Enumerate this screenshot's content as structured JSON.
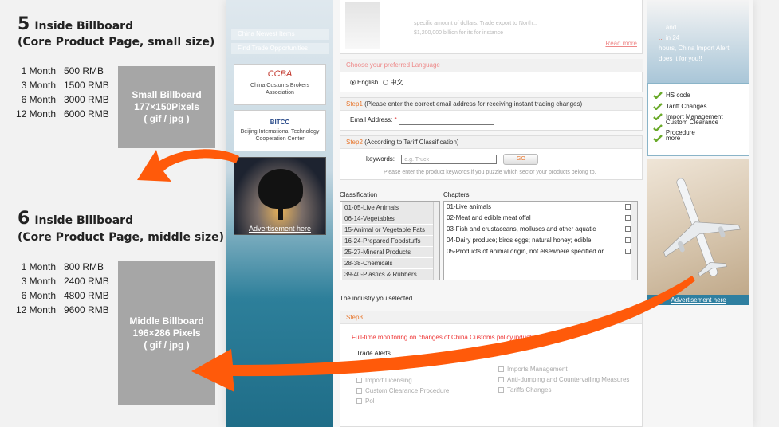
{
  "annotations": [
    {
      "num": "5",
      "line1": "Inside Billboard",
      "line2": "(Core Product Page, small size)",
      "prices": [
        [
          "1 Month",
          "500 RMB"
        ],
        [
          "3 Month",
          "1500 RMB"
        ],
        [
          "6 Month",
          "3000 RMB"
        ],
        [
          "12 Month",
          "6000 RMB"
        ]
      ],
      "box_title": "Small Billboard",
      "box_size": "177×150Pixels",
      "box_fmt": "( gif / jpg )"
    },
    {
      "num": "6",
      "line1": "Inside Billboard",
      "line2": "(Core Product Page, middle size)",
      "prices": [
        [
          "1 Month",
          "800 RMB"
        ],
        [
          "3 Month",
          "2400 RMB"
        ],
        [
          "6 Month",
          "4800 RMB"
        ],
        [
          "12 Month",
          "9600 RMB"
        ]
      ],
      "box_title": "Middle Billboard",
      "box_size": "196×286 Pixels",
      "box_fmt": "( gif / jpg )"
    }
  ],
  "left_nav": [
    "China Newest Items",
    "Find Trade Opportunities"
  ],
  "logos": [
    {
      "mark": "CCBA",
      "name": "China Customs Brokers Association"
    },
    {
      "mark": "BITCC",
      "name": "Beijing International Technology Cooperation Center"
    }
  ],
  "ad_link": "Advertisement here",
  "top_text": {
    "line1": "specific amount of dollars. Trade export to North...",
    "line2": "$1,200,000 billion for its for instance",
    "read_more": "Read more"
  },
  "language": {
    "label": "Choose your preferred Language",
    "english": "English",
    "chinese": "中文"
  },
  "step1": {
    "label": "Step1",
    "desc": "(Please enter the correct email address for receiving instant trading changes)",
    "email_label": "Email Address:",
    "required": "*"
  },
  "step2": {
    "label": "Step2",
    "desc": "(According to Tariff Classification)",
    "kw_label": "keywords:",
    "kw_placeholder": "e.g. Truck",
    "go": "GO",
    "hint": "Please enter the product keywords,if you puzzle which sector your products belong to."
  },
  "classification": {
    "header": "Classification",
    "items": [
      "01-05-Live Animals",
      "06-14-Vegetables",
      "15-Animal or Vegetable Fats",
      "16-24-Prepared Foodstuffs",
      "25-27-Mineral Products",
      "28-38-Chemicals",
      "39-40-Plastics & Rubbers"
    ]
  },
  "chapters": {
    "header": "Chapters",
    "items": [
      "01-Live animals",
      "02-Meat and edible meat offal",
      "03-Fish and crustaceans, molluscs and other aquatic",
      "04-Dairy produce; birds eggs; natural honey; edible",
      "05-Products of animal origin, not elsewhere specified or"
    ]
  },
  "industry_selected": "The industry you selected",
  "step3": {
    "label": "Step3",
    "monitor": "Full-time monitoring on changes of China Customs policy,industry...",
    "trade_alerts": "Trade Alerts",
    "left_opts": [
      "Import Licensing",
      "Custom Clearance Procedure",
      "Pol"
    ],
    "right_opts": [
      "Imports Management",
      "Anti-dumping and Countervailing Measures",
      "Tariffs Changes"
    ]
  },
  "promo": {
    "red1": "...",
    "red2": "...",
    "l1": "and",
    "l2": "in 24",
    "l3": "hours, China Import Alert",
    "l4": "does it for you!!"
  },
  "features": [
    "HS code",
    "Tariff Changes",
    "Import Management",
    "Custom Clearance Procedure",
    "more"
  ],
  "plane_link": "Advertisement here",
  "colors": {
    "accent_orange": "#e8772e",
    "arrow": "#ff5a0a",
    "gray_box": "#a6a6a6"
  }
}
